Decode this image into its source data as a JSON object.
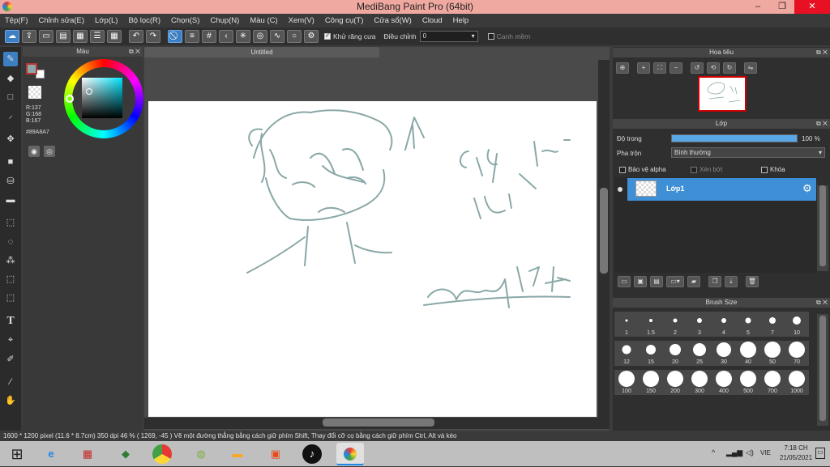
{
  "window": {
    "title": "MediBang Paint Pro (64bit)",
    "minimize": "–",
    "restore": "❐",
    "close": "✕"
  },
  "menu": [
    "Tệp(F)",
    "Chỉnh sửa(E)",
    "Lớp(L)",
    "Bộ lọc(R)",
    "Chọn(S)",
    "Chụp(N)",
    "Màu (C)",
    "Xem(V)",
    "Công cụ(T)",
    "Cửa sổ(W)",
    "Cloud",
    "Help"
  ],
  "toolbar": {
    "antialias_label": "Khử răng cưa",
    "correction_label": "Điều chỉnh",
    "correction_value": "0",
    "edge_label": "Canh mềm"
  },
  "color_panel": {
    "title": "Màu",
    "r": "R:137",
    "g": "G:168",
    "b": "B:167",
    "hex": "#89A8A7",
    "fg": "#89A8A7"
  },
  "document": {
    "tab": "Untitled",
    "stroke_color": "#89A8A7"
  },
  "navigator": {
    "title": "Hoa tiêu"
  },
  "layer_panel": {
    "title": "Lớp",
    "opacity_label": "Độ trong",
    "opacity_value": "100 %",
    "opacity": 1.0,
    "blend_label": "Pha trộn",
    "blend_value": "Bình thường",
    "protect_alpha": "Bảo vệ alpha",
    "clipping": "Xén bớt",
    "lock": "Khóa",
    "layers": [
      {
        "name": "Lớp1",
        "selected": true
      }
    ]
  },
  "brush_size": {
    "title": "Brush Size",
    "sizes": [
      "1",
      "1.5",
      "2",
      "3",
      "4",
      "5",
      "7",
      "10",
      "12",
      "15",
      "20",
      "25",
      "30",
      "40",
      "50",
      "70",
      "100",
      "150",
      "200",
      "300",
      "400",
      "500",
      "700",
      "1000"
    ]
  },
  "status": {
    "text": "1600 * 1200 pixel   (11.6 * 8.7cm)   350 dpi   46 %   ( 1269, -45 )   Vẽ một đường thẳng bằng cách giữ phím Shift, Thay đổi cỡ cọ bằng cách giữ phím Ctrl, Alt và kéo"
  },
  "taskbar": {
    "time": "7:18 CH",
    "date": "21/05/2021",
    "lang": "VIE",
    "tray": "^"
  }
}
